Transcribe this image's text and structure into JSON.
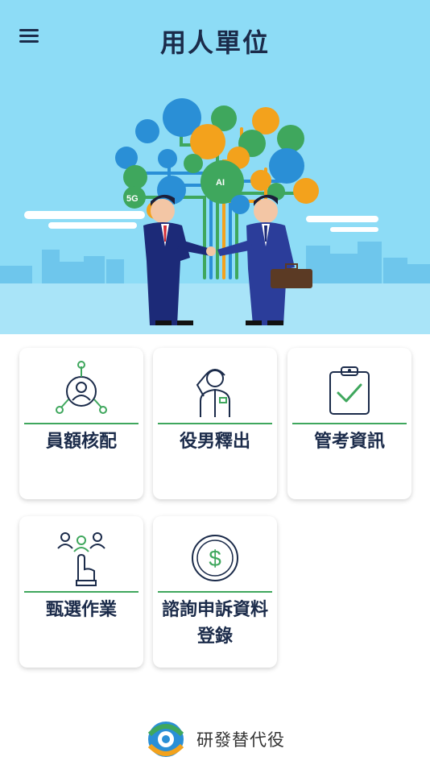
{
  "header": {
    "title": "用人單位",
    "menu_icon": "hamburger-menu-icon"
  },
  "hero": {
    "illustration": "business-handshake-tech-tree",
    "tree_nodes": [
      "5G",
      "AI"
    ],
    "colors": {
      "sky": "#8ddcf6",
      "city": "#6ec6ec",
      "tree_blue": "#2a8fd6",
      "tree_green": "#3fa75d",
      "tree_orange": "#f3a21c"
    }
  },
  "menu": [
    {
      "label": "員額核配",
      "icon": "user-network-icon"
    },
    {
      "label": "役男釋出",
      "icon": "soldier-salute-icon"
    },
    {
      "label": "管考資訊",
      "icon": "clipboard-check-icon"
    },
    {
      "label": "甄選作業",
      "icon": "select-person-icon"
    },
    {
      "label": "諮詢申訴資料登錄",
      "icon": "dollar-coin-icon"
    }
  ],
  "footer": {
    "brand": "研發替代役",
    "logo": "research-substitute-service-logo"
  },
  "colors": {
    "accent_green": "#3fa75d",
    "text_dark": "#1b2b4a"
  }
}
